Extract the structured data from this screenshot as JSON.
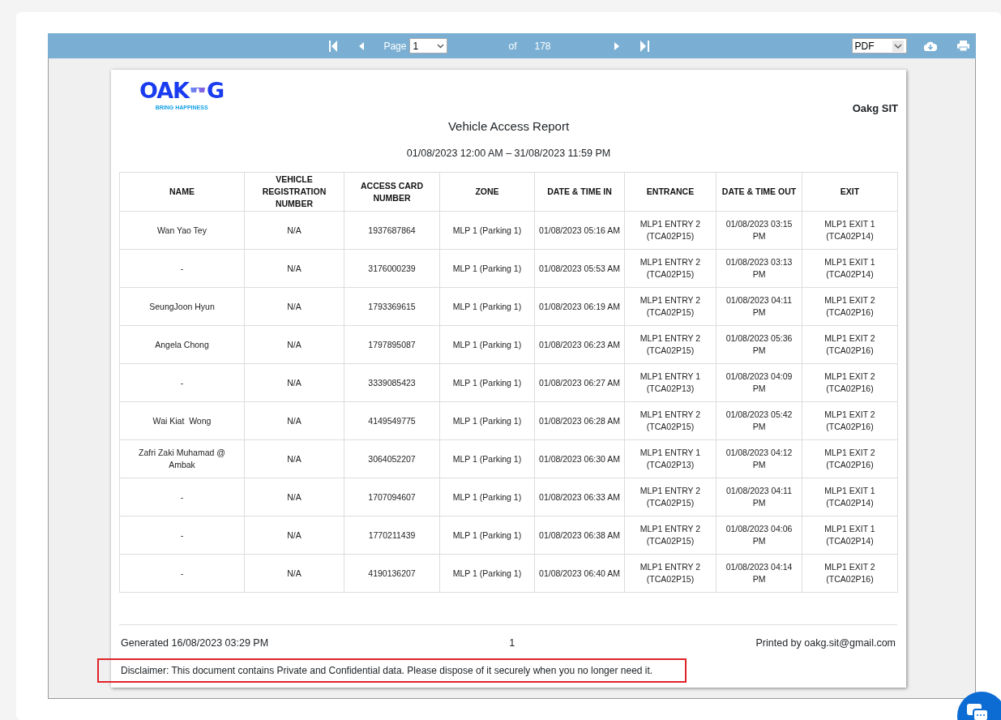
{
  "toolbar": {
    "page_label": "Page",
    "page_value": "1",
    "of_label": "of",
    "total_pages": "178",
    "export_format": "PDF"
  },
  "report": {
    "logo": {
      "left": "OAK",
      "right": "G",
      "tagline": "BRING HAPPINESS"
    },
    "company": "Oakg SIT",
    "title": "Vehicle Access Report",
    "date_range": "01/08/2023 12:00 AM – 31/08/2023 11:59 PM",
    "table": {
      "columns": [
        "NAME",
        "VEHICLE REGISTRATION NUMBER",
        "ACCESS CARD NUMBER",
        "ZONE",
        "DATE & TIME IN",
        "ENTRANCE",
        "DATE & TIME OUT",
        "EXIT"
      ],
      "rows": [
        [
          "Wan Yao Tey",
          "N/A",
          "1937687864",
          "MLP 1 (Parking 1)",
          "01/08/2023 05:16 AM",
          "MLP1 ENTRY 2 (TCA02P15)",
          "01/08/2023 03:15 PM",
          "MLP1 EXIT 1 (TCA02P14)"
        ],
        [
          "-",
          "N/A",
          "3176000239",
          "MLP 1 (Parking 1)",
          "01/08/2023 05:53 AM",
          "MLP1 ENTRY 2 (TCA02P15)",
          "01/08/2023 03:13 PM",
          "MLP1 EXIT 1 (TCA02P14)"
        ],
        [
          "SeungJoon Hyun",
          "N/A",
          "1793369615",
          "MLP 1 (Parking 1)",
          "01/08/2023 06:19 AM",
          "MLP1 ENTRY 2 (TCA02P15)",
          "01/08/2023 04:11 PM",
          "MLP1 EXIT 2 (TCA02P16)"
        ],
        [
          "Angela Chong",
          "N/A",
          "1797895087",
          "MLP 1 (Parking 1)",
          "01/08/2023 06:23 AM",
          "MLP1 ENTRY 2 (TCA02P15)",
          "01/08/2023 05:36 PM",
          "MLP1 EXIT 2 (TCA02P16)"
        ],
        [
          "-",
          "N/A",
          "3339085423",
          "MLP 1 (Parking 1)",
          "01/08/2023 06:27 AM",
          "MLP1 ENTRY 1 (TCA02P13)",
          "01/08/2023 04:09 PM",
          "MLP1 EXIT 2 (TCA02P16)"
        ],
        [
          "Wai Kiat  Wong",
          "N/A",
          "4149549775",
          "MLP 1 (Parking 1)",
          "01/08/2023 06:28 AM",
          "MLP1 ENTRY 2 (TCA02P15)",
          "01/08/2023 05:42 PM",
          "MLP1 EXIT 2 (TCA02P16)"
        ],
        [
          "Zafri Zaki Muhamad @ Ambak",
          "N/A",
          "3064052207",
          "MLP 1 (Parking 1)",
          "01/08/2023 06:30 AM",
          "MLP1 ENTRY 1 (TCA02P13)",
          "01/08/2023 04:12 PM",
          "MLP1 EXIT 2 (TCA02P16)"
        ],
        [
          "-",
          "N/A",
          "1707094607",
          "MLP 1 (Parking 1)",
          "01/08/2023 06:33 AM",
          "MLP1 ENTRY 2 (TCA02P15)",
          "01/08/2023 04:11 PM",
          "MLP1 EXIT 1 (TCA02P14)"
        ],
        [
          "-",
          "N/A",
          "1770211439",
          "MLP 1 (Parking 1)",
          "01/08/2023 06:38 AM",
          "MLP1 ENTRY 2 (TCA02P15)",
          "01/08/2023 04:06 PM",
          "MLP1 EXIT 1 (TCA02P14)"
        ],
        [
          "-",
          "N/A",
          "4190136207",
          "MLP 1 (Parking 1)",
          "01/08/2023 06:40 AM",
          "MLP1 ENTRY 2 (TCA02P15)",
          "01/08/2023 04:14 PM",
          "MLP1 EXIT 2 (TCA02P16)"
        ]
      ]
    },
    "footer": {
      "generated": "Generated 16/08/2023 03:29 PM",
      "page_number": "1",
      "printed_by": "Printed by oakg.sit@gmail.com",
      "disclaimer": "Disclaimer: This document contains Private and Confidential data. Please dispose of it securely when you no longer need it.",
      "disclaimer_highlighted": true
    }
  }
}
